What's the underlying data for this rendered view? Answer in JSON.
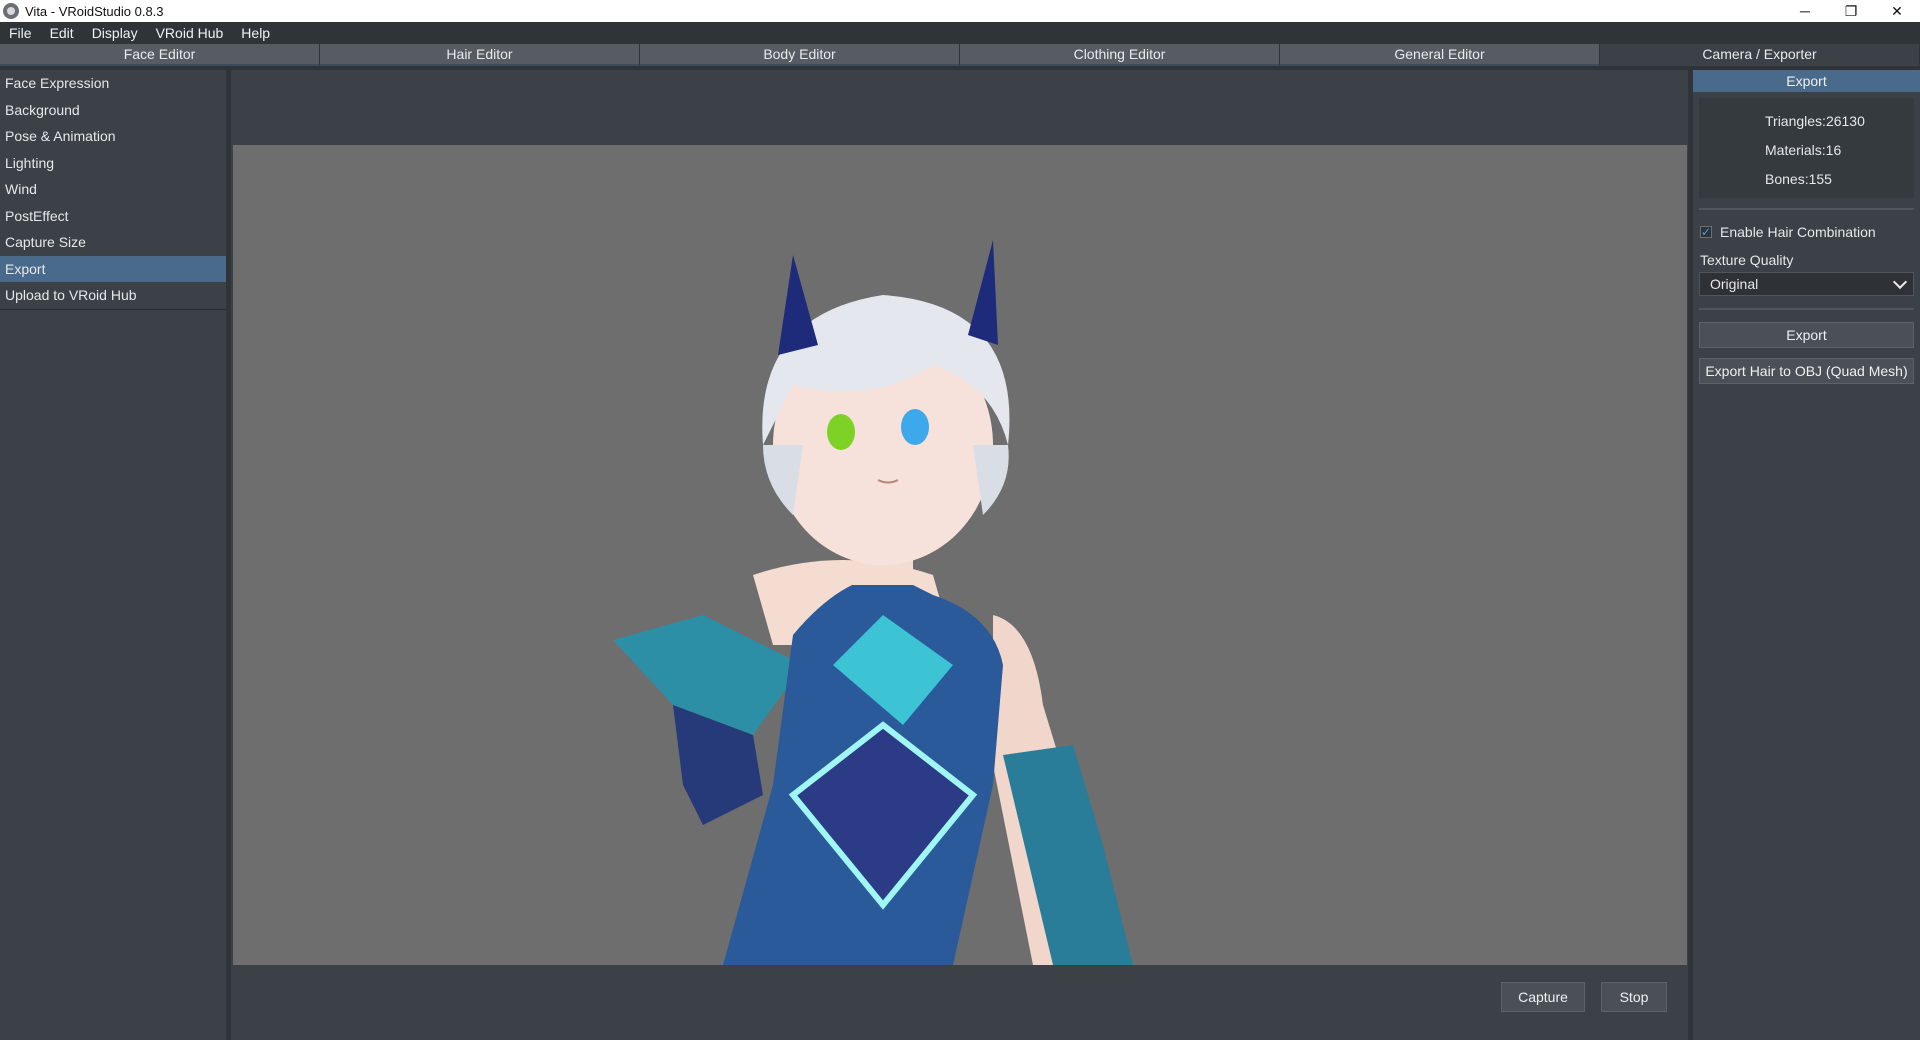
{
  "window": {
    "title": "Vita - VRoidStudio 0.8.3",
    "controls": {
      "minimize": "─",
      "restore": "❐",
      "close": "✕"
    }
  },
  "menu": [
    "File",
    "Edit",
    "Display",
    "VRoid Hub",
    "Help"
  ],
  "tabs": [
    {
      "label": "Face Editor",
      "active": false
    },
    {
      "label": "Hair Editor",
      "active": false
    },
    {
      "label": "Body Editor",
      "active": false
    },
    {
      "label": "Clothing Editor",
      "active": false
    },
    {
      "label": "General Editor",
      "active": false
    },
    {
      "label": "Camera / Exporter",
      "active": true
    }
  ],
  "sidebar": {
    "items": [
      {
        "label": "Face Expression"
      },
      {
        "label": "Background"
      },
      {
        "label": "Pose & Animation"
      },
      {
        "label": "Lighting"
      },
      {
        "label": "Wind"
      },
      {
        "label": "PostEffect"
      },
      {
        "label": "Capture Size"
      },
      {
        "label": "Export",
        "active": true
      },
      {
        "label": "Upload to VRoid Hub"
      }
    ]
  },
  "viewport": {
    "capture_label": "Capture",
    "stop_label": "Stop"
  },
  "export_panel": {
    "header": "Export",
    "triangles": "Triangles:26130",
    "materials": "Materials:16",
    "bones": "Bones:155",
    "enable_hair_combination_label": "Enable Hair Combination",
    "enable_hair_combination_checked": true,
    "checkmark": "✓",
    "texture_quality_label": "Texture Quality",
    "texture_quality_value": "Original",
    "export_button": "Export",
    "export_hair_button": "Export Hair to OBJ (Quad Mesh)"
  },
  "colors": {
    "accent": "#4a6a8c",
    "panel": "#3b4146",
    "viewport_bg": "#6e6e6e"
  }
}
